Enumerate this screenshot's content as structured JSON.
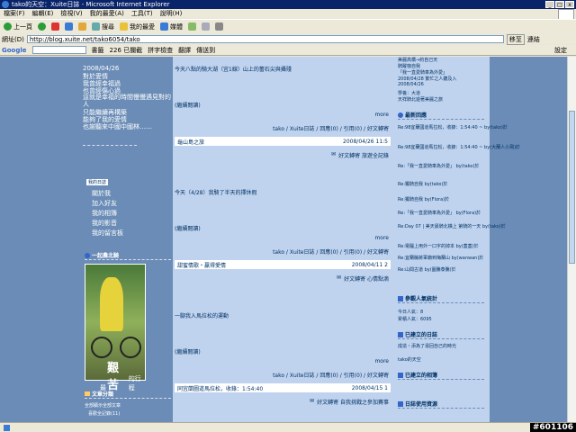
{
  "window": {
    "title": "tako的天空：Xuite日誌 - Microsoft Internet Explorer",
    "buttons": [
      "_",
      "□",
      "x"
    ]
  },
  "menu": [
    "檔案(F)",
    "編輯(E)",
    "檢視(V)",
    "我的最愛(A)",
    "工具(T)",
    "說明(H)"
  ],
  "toolbar": {
    "back": "上一頁",
    "search": "搜尋",
    "favorites": "我的最愛",
    "media": "媒體"
  },
  "address": {
    "label": "網址(D)",
    "url": "http://blog.xuite.net/tako6054/tako",
    "go": "移至",
    "links": "連結"
  },
  "gbar": {
    "brand": "Google",
    "pagerank": "書籤",
    "blocked": "226 已攔截",
    "spell": "拼字檢查",
    "translate": "翻譯",
    "send": "傳送到",
    "settings": "設定"
  },
  "left": {
    "date": "2008/04/26",
    "poem": [
      "對於愛情",
      "我曾經幸福過",
      "也曾經傷心過",
      "這就是幸福的時間慢慢遇見對的人",
      "只能繼續再構築",
      "能夠了我的愛情",
      "也謝聽來中國中國林……"
    ],
    "menu_title": "我的日誌",
    "menu": [
      "關於我",
      "加入好友",
      "我的相簿",
      "我的影音",
      "我的留言板"
    ],
    "section1": "一起農北騎",
    "photo_caption_big": "艱苦",
    "photo_caption_small": "的行程",
    "photo_caption_pre": "最",
    "section2": "文章分類",
    "cat1": "全部顯示全部文章",
    "cat2": "喜歡全記錄(11)"
  },
  "posts": [
    {
      "title": "今天八點的騎大湖（宜1線）山上的蕾石尖與攝殘",
      "read": "(繼續閱讀)",
      "more": "more",
      "meta": "tako / Xuite日誌 / 回應(0) / 引用(0) / 好文轉寄",
      "ref": "龜山島之旅",
      "date": "2008/04/26 11:5",
      "act": "好文轉寄  旅遊全記錄"
    },
    {
      "title": "今天（4/28）我騎了半天的擇休假",
      "read": "(繼續閱讀)",
      "more": "more",
      "meta": "tako / Xuite日誌 / 回應(0) / 引用(0) / 好文轉寄",
      "ref": "甜蜜情歌・贏得愛情",
      "date": "2008/04/11 2",
      "act": "好文轉寄  心情點滴"
    },
    {
      "title": "一腳我入馬拉松的運動",
      "read": "(繼續閱讀)",
      "more": "more",
      "meta": "tako / Xuite日誌 / 回應(0) / 引用(0) / 好文轉寄",
      "ref": "同宜蘭圖道馬拉松，收錄：1:54:40",
      "date": "2008/04/15 1",
      "act": "好文轉寄  自我挑戰之參加賽事"
    }
  ],
  "right": {
    "top_lines": [
      "美麗高橋→約自己天",
      "騎蹤咖自我",
      "「我一直愛騎車為外愛」",
      "2008/04/28 繁忙之人聽及入",
      "2008/04/26",
      "學養：大道",
      "天祥騎北遊著美麗之旅"
    ],
    "s1": "最新回應",
    "replies": [
      "Re:98宜蘭國道馬拉松，收錄：1:54:40 ~ by(tako)於",
      "Re:98宜蘭國道馬拉松，收錄：1:54:40 ~ by(大蘭人小飛)於",
      "Re:「我一直愛騎車為外愛」 by(tako)於",
      "Re:獨騎自我 by(tako)於",
      "Re:獨騎自我 by(Flora)於",
      "Re:「我一直愛騎車為外愛」 by(Flora)於",
      "Re:Day 07 | 美天晨騎北橫上 第騎的一天 by(tako)於",
      "Re:電腦上用外一口字的掉本 by(蓋蓋)於",
      "Re:宜蘭縣將軍廟到梅蘭山 by(wanwan)於",
      "Re:山間古道 by(圖騰泰騰)於"
    ],
    "s2": "參觀人氣統計",
    "today": "今日人氣：8",
    "total": "累積人氣：6095",
    "s3": "已建立的日誌",
    "journals": [
      "成造・添為了尋回自己的時光",
      "tako的天空"
    ],
    "s4": "已建立的相簿",
    "s5": "日誌使用資源"
  },
  "status": {
    "badge": "#601106"
  }
}
